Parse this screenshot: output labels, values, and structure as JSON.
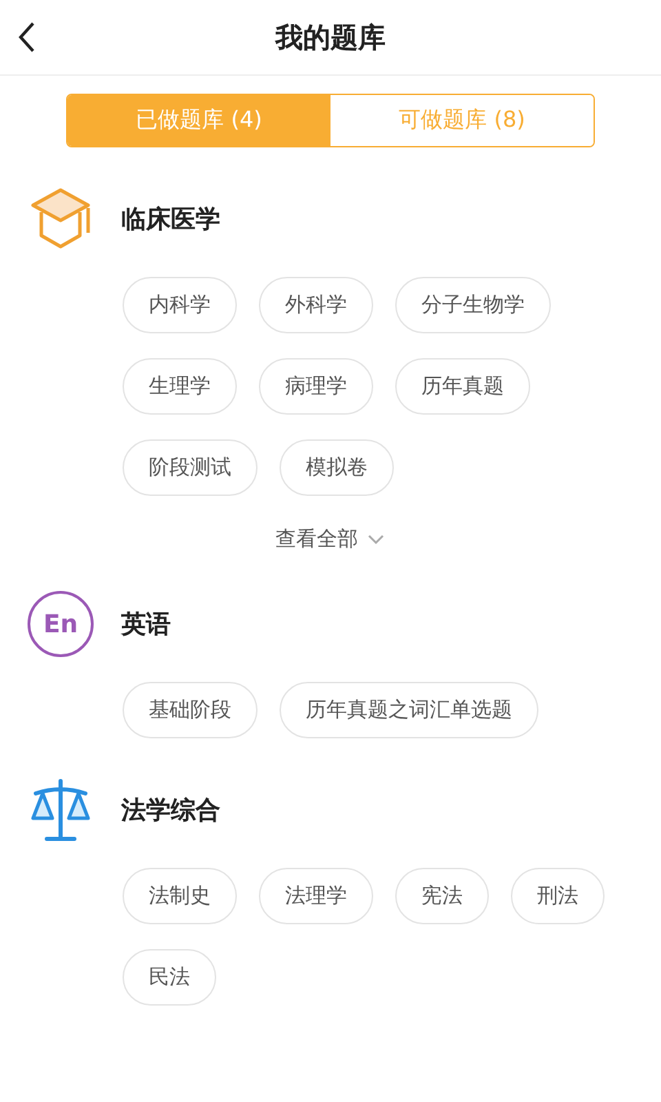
{
  "header": {
    "title": "我的题库"
  },
  "tabs": [
    {
      "label": "已做题库 (4)",
      "selected": true
    },
    {
      "label": "可做题库 (8)",
      "selected": false
    }
  ],
  "categories": [
    {
      "kind": "cap",
      "title": "临床医学",
      "tags": [
        "内科学",
        "外科学",
        "分子生物学",
        "生理学",
        "病理学",
        "历年真题",
        "阶段测试",
        "模拟卷"
      ],
      "show_all": "查看全部"
    },
    {
      "kind": "en",
      "icon_text": "En",
      "title": "英语",
      "tags": [
        "基础阶段",
        "历年真题之词汇单选题"
      ]
    },
    {
      "kind": "scales",
      "title": "法学综合",
      "tags": [
        "法制史",
        "法理学",
        "宪法",
        "刑法",
        "民法"
      ]
    }
  ]
}
